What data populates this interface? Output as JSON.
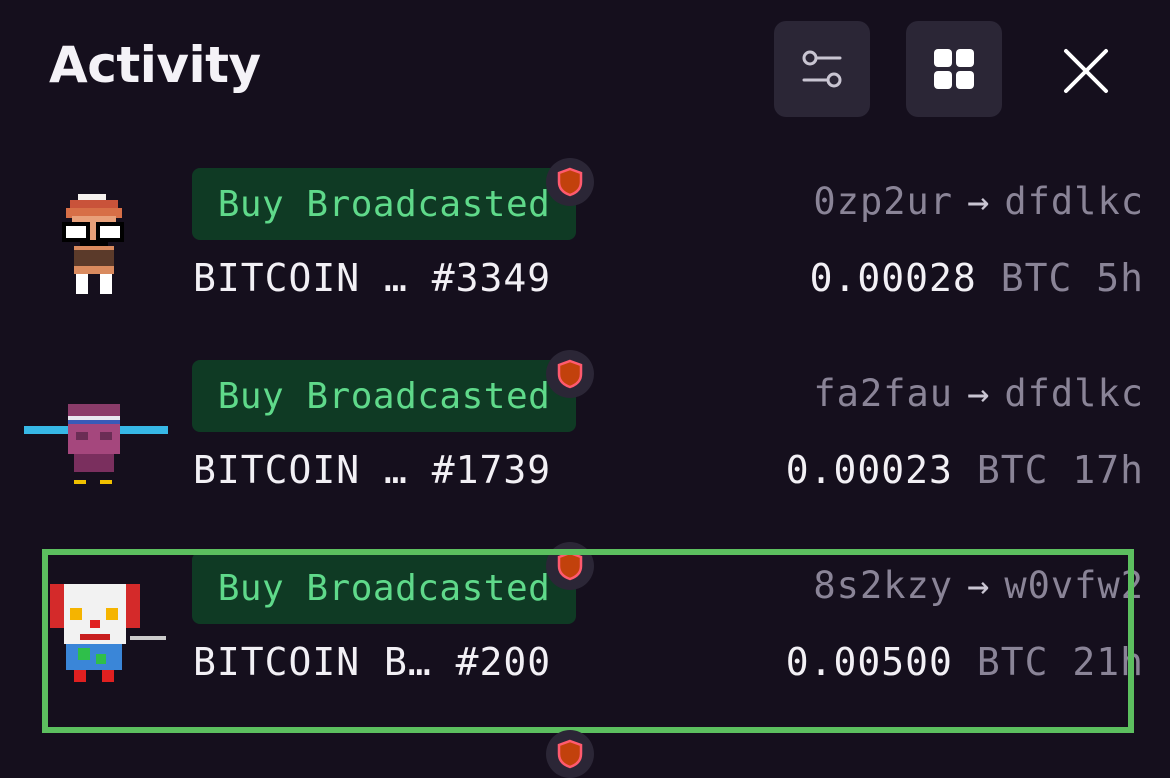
{
  "header": {
    "title": "Activity"
  },
  "colors": {
    "background": "#150f1d",
    "badge_bg": "#0f3a24",
    "badge_text": "#5fd98a",
    "highlight": "#5cbf5f",
    "muted_text": "#8a8497",
    "icon_button_bg": "#2b2636"
  },
  "icons": {
    "filter": "sliders-icon",
    "grid": "grid-view-icon",
    "close": "close-icon",
    "shield": "shield-icon"
  },
  "activities": [
    {
      "status": "Buy Broadcasted",
      "name": "BITCOIN … #3349",
      "from": "0zp2ur",
      "arrow": "→",
      "to": "dfdlkc",
      "price": "0.00028",
      "unit": "BTC",
      "ago": "5h"
    },
    {
      "status": "Buy Broadcasted",
      "name": "BITCOIN … #1739",
      "from": "fa2fau",
      "arrow": "→",
      "to": "dfdlkc",
      "price": "0.00023",
      "unit": "BTC",
      "ago": "17h"
    },
    {
      "status": "Buy Broadcasted",
      "name": "BITCOIN B… #200",
      "from": "8s2kzy",
      "arrow": "→",
      "to": "w0vfw2",
      "price": "0.00500",
      "unit": "BTC",
      "ago": "21h"
    }
  ]
}
